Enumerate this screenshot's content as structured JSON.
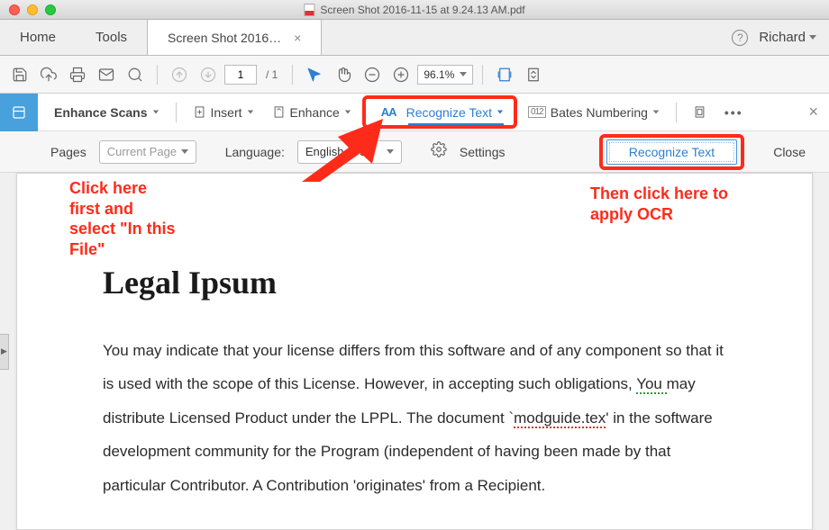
{
  "title_bar": {
    "doc_title": "Screen Shot 2016-11-15 at 9.24.13 AM.pdf"
  },
  "tabs": {
    "home": "Home",
    "tools": "Tools",
    "doc": "Screen Shot 2016…",
    "user": "Richard"
  },
  "toolbar": {
    "page_current": "1",
    "page_sep": "/ 1",
    "zoom": "96.1%"
  },
  "enhance_bar": {
    "enhance_scans": "Enhance Scans",
    "insert": "Insert",
    "enhance": "Enhance",
    "recognize_text": "Recognize Text",
    "bates": "Bates Numbering",
    "aa": "AA"
  },
  "settings_bar": {
    "pages_lbl": "Pages",
    "pages_val": "Current Page",
    "lang_lbl": "Language:",
    "lang_val": "English (US)",
    "settings": "Settings",
    "recognize_btn": "Recognize Text",
    "close": "Close"
  },
  "document": {
    "h1": "Legal Ipsum",
    "p_1": "You may indicate that your license differs from this software and of any component so that it is used with the scope of this License. However, in accepting such obligations, ",
    "p_you": "You ",
    "p_2": "may distribute Licensed Product under the LPPL. The document `",
    "p_mod": "modguide.tex",
    "p_3": "' in the software development community for the Program (independent of having been made by that particular Contributor. A Contribution 'originates' from a Recipient."
  },
  "annotations": {
    "left": "Click here first and select \"In this File\"",
    "right": "Then click here to apply OCR"
  }
}
